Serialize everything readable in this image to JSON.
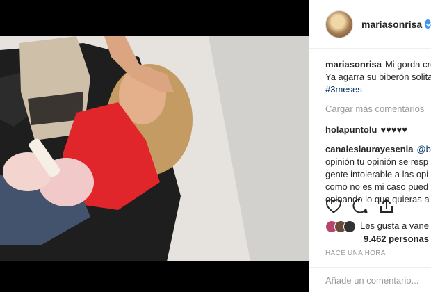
{
  "post": {
    "username": "mariasonrisa",
    "verified": true,
    "caption_lines": [
      "Mi gorda cre",
      "Ya agarra su biberón solita",
      "#3meses"
    ],
    "load_more_label": "Cargar más comentarios",
    "comments": [
      {
        "user": "holapuntolu",
        "text": "♥♥♥♥♥"
      },
      {
        "user": "canaleslaurayesenia",
        "text_lines": [
          "@bre",
          "opinión tu opinión se resp",
          "gente intolerable a las opi",
          "como no es mi caso pued",
          "opinando lo que quieras a"
        ]
      }
    ],
    "likes_line": "Les gusta a vane",
    "likes_count": "9.462 personas",
    "time": "HACE UNA HORA",
    "add_comment_placeholder": "Añade un comentario..."
  },
  "colors": {
    "verified": "#3897f0",
    "hashtag": "#003569",
    "shirt": "#e0262a",
    "sofa": "#1e1e1e"
  },
  "icons": [
    "heart-icon",
    "comment-icon",
    "share-icon",
    "verified-badge-icon"
  ]
}
